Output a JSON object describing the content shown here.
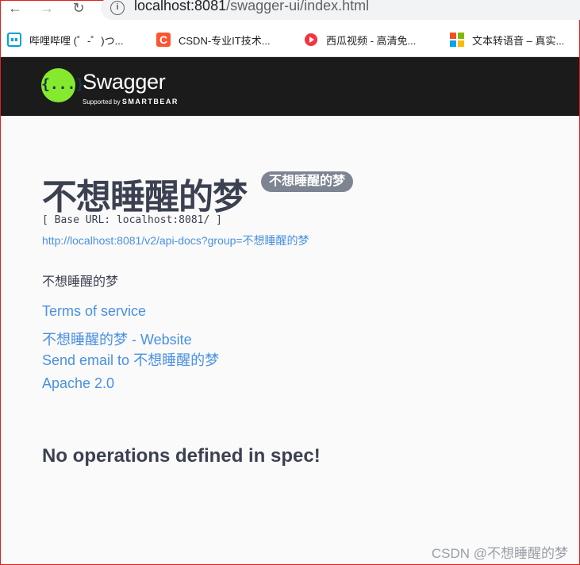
{
  "browser": {
    "url_host": "localhost:8081",
    "url_path": "/swagger-ui/index.html",
    "bookmarks": [
      {
        "label": "哔哩哔哩 (゜-゜)つ...",
        "icon": "bilibili-icon"
      },
      {
        "label": "CSDN-专业IT技术...",
        "icon": "csdn-icon"
      },
      {
        "label": "西瓜视频 - 高清免...",
        "icon": "xigua-icon"
      },
      {
        "label": "文本转语音 – 真实...",
        "icon": "microsoft-icon"
      }
    ]
  },
  "topbar": {
    "logo_text": "Swagger",
    "logo_glyph": "{...}",
    "supported_by": "Supported by",
    "smartbear": "SMARTBEAR"
  },
  "info": {
    "title": "不想睡醒的梦",
    "version": "不想睡醒的梦",
    "base_url": "[ Base URL: localhost:8081/ ]",
    "spec_url": "http://localhost:8081/v2/api-docs?group=不想睡醒的梦",
    "description": "不想睡醒的梦",
    "terms": "Terms of service",
    "website": "不想睡醒的梦 - Website",
    "email": "Send email to 不想睡醒的梦",
    "license": "Apache 2.0"
  },
  "operations": {
    "empty_message": "No operations defined in spec!"
  },
  "watermark": "CSDN @不想睡醒的梦",
  "colors": {
    "topbar_bg": "#1b1b1b",
    "logo_green": "#85ea2d",
    "link": "#4990e2",
    "text": "#3b4151",
    "badge": "#7d8492"
  }
}
